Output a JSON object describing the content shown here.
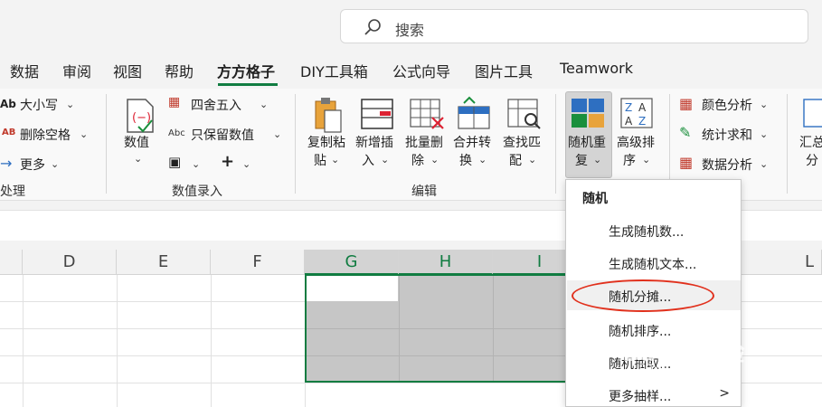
{
  "search": {
    "placeholder": "搜索"
  },
  "tabs": [
    "数据",
    "审阅",
    "视图",
    "帮助",
    "方方格子",
    "DIY工具箱",
    "公式向导",
    "图片工具",
    "Teamwork"
  ],
  "active_tab": "方方格子",
  "ribbon": {
    "text_group": {
      "case": "大小写",
      "remove_space": "删除空格",
      "more": "更多",
      "group_label": "处理"
    },
    "numeric_group": {
      "numeric": "数值",
      "round": "四舍五入",
      "keep_numeric": "只保留数值",
      "group_label": "数值录入"
    },
    "edit_group": {
      "copy_paste_1": "复制粘",
      "copy_paste_2": "贴",
      "insert_1": "新增插",
      "insert_2": "入",
      "batch_delete_1": "批量删",
      "batch_delete_2": "除",
      "merge_1": "合并转",
      "merge_2": "换",
      "find_1": "查找匹",
      "find_2": "配",
      "group_label": "编辑"
    },
    "random_group": {
      "random_1": "随机重",
      "random_2": "复",
      "sort_1": "高级排",
      "sort_2": "序"
    },
    "analysis_group": {
      "color": "颜色分析",
      "stats": "统计求和",
      "data": "数据分析",
      "summary_1": "汇总",
      "summary_2": "分"
    }
  },
  "columns": [
    "D",
    "E",
    "F",
    "G",
    "H",
    "I",
    "L"
  ],
  "menu": {
    "title": "随机",
    "items": [
      "生成随机数...",
      "生成随机文本...",
      "随机分摊...",
      "随机排序...",
      "随机抽取...",
      "更多抽样..."
    ],
    "submenu_arrow": ">"
  },
  "watermark": {
    "brand": "Baidu经验",
    "url": "jingyan.baidu.com"
  },
  "colors": {
    "accent": "#107c41",
    "highlight": "#e1301c"
  }
}
